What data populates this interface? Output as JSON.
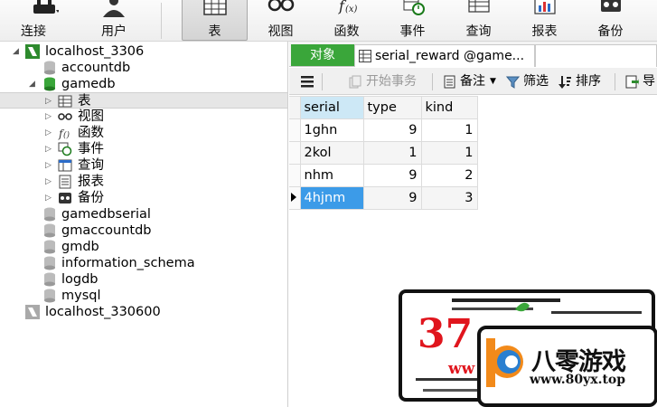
{
  "toolbar": {
    "items": [
      {
        "label": "连接",
        "icon": "plug-icon"
      },
      {
        "label": "用户",
        "icon": "user-icon"
      },
      {
        "label": "表",
        "icon": "table-icon",
        "active": true
      },
      {
        "label": "视图",
        "icon": "glasses-icon"
      },
      {
        "label": "函数",
        "icon": "function-icon"
      },
      {
        "label": "事件",
        "icon": "clock-icon"
      },
      {
        "label": "查询",
        "icon": "query-icon"
      },
      {
        "label": "报表",
        "icon": "report-icon"
      },
      {
        "label": "备份",
        "icon": "backup-icon"
      }
    ]
  },
  "tree": {
    "connection1": "localhost_3306",
    "db_accountdb": "accountdb",
    "db_gamedb": "gamedb",
    "gamedb_children": {
      "tables": "表",
      "views": "视图",
      "functions": "函数",
      "events": "事件",
      "queries": "查询",
      "reports": "报表",
      "backups": "备份"
    },
    "db_gamedbserial": "gamedbserial",
    "db_gmaccountdb": "gmaccountdb",
    "db_gmdb": "gmdb",
    "db_information_schema": "information_schema",
    "db_logdb": "logdb",
    "db_mysql": "mysql",
    "connection2": "localhost_330600"
  },
  "tabs": {
    "objects": "对象",
    "table_tab": "serial_reward @game..."
  },
  "subtoolbar": {
    "begin_transaction": "开始事务",
    "note": "备注",
    "filter": "筛选",
    "sort": "排序",
    "import": "导"
  },
  "grid": {
    "columns": [
      "serial",
      "type",
      "kind"
    ],
    "rows": [
      [
        "1ghn",
        "9",
        "1"
      ],
      [
        "2kol",
        "1",
        "1"
      ],
      [
        "nhm",
        "9",
        "2"
      ],
      [
        "4hjnm",
        "9",
        "3"
      ]
    ],
    "current_row": 3
  },
  "watermark": {
    "brand_cn": "八零游戏",
    "brand_url": "www.80yx.top",
    "number": "37",
    "partial_url": "ww"
  },
  "colors": {
    "objects_tab_bg": "#3aa63a",
    "selected_cell_bg": "#3c9be8",
    "selected_header_bg": "#cde8f6"
  }
}
